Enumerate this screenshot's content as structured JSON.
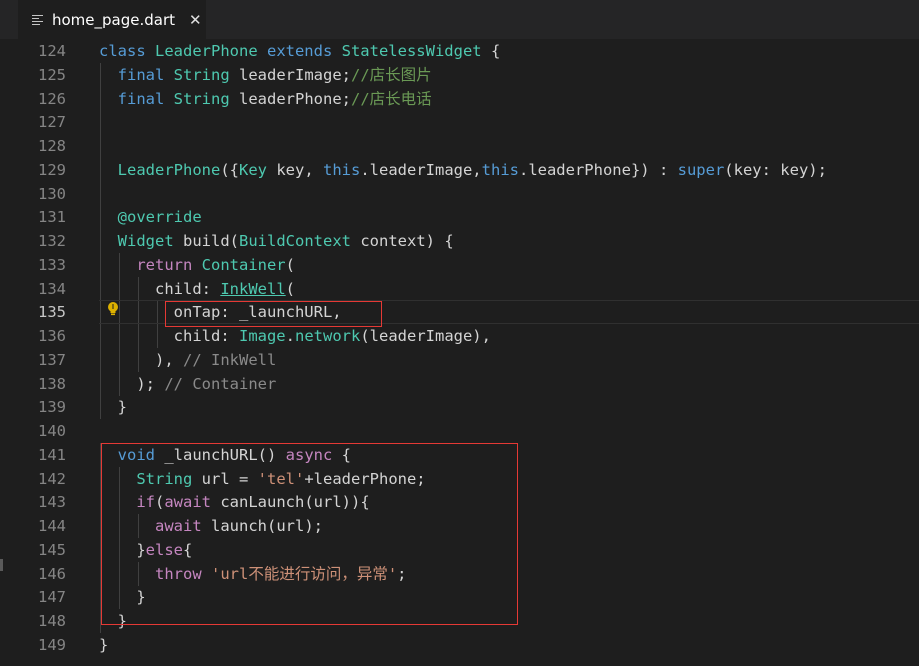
{
  "tab": {
    "filename": "home_page.dart",
    "close_glyph": "✕",
    "file_icon": "lines-file-icon"
  },
  "editor": {
    "active_line": "135",
    "lines": [
      {
        "n": "124",
        "tokens": [
          [
            "kw",
            "class "
          ],
          [
            "ty",
            "LeaderPhone "
          ],
          [
            "kw",
            "extends "
          ],
          [
            "ty",
            "StatelessWidget "
          ],
          [
            "var",
            "{"
          ]
        ]
      },
      {
        "n": "125",
        "tokens": [
          [
            "var",
            "  "
          ],
          [
            "kw",
            "final "
          ],
          [
            "ty",
            "String "
          ],
          [
            "var",
            "leaderImage;"
          ],
          [
            "cm",
            "//店长图片"
          ]
        ]
      },
      {
        "n": "126",
        "tokens": [
          [
            "var",
            "  "
          ],
          [
            "kw",
            "final "
          ],
          [
            "ty",
            "String "
          ],
          [
            "var",
            "leaderPhone;"
          ],
          [
            "cm",
            "//店长电话"
          ]
        ]
      },
      {
        "n": "127",
        "tokens": []
      },
      {
        "n": "128",
        "tokens": []
      },
      {
        "n": "129",
        "tokens": [
          [
            "var",
            "  "
          ],
          [
            "ty",
            "LeaderPhone"
          ],
          [
            "var",
            "({"
          ],
          [
            "ty",
            "Key "
          ],
          [
            "var",
            "key, "
          ],
          [
            "kw",
            "this"
          ],
          [
            "var",
            ".leaderImage,"
          ],
          [
            "kw",
            "this"
          ],
          [
            "var",
            ".leaderPhone}) : "
          ],
          [
            "kw",
            "super"
          ],
          [
            "var",
            "(key: key);"
          ]
        ]
      },
      {
        "n": "130",
        "tokens": []
      },
      {
        "n": "131",
        "tokens": [
          [
            "var",
            "  "
          ],
          [
            "dec",
            "@override"
          ]
        ]
      },
      {
        "n": "132",
        "tokens": [
          [
            "var",
            "  "
          ],
          [
            "ty",
            "Widget "
          ],
          [
            "var",
            "build("
          ],
          [
            "ty",
            "BuildContext "
          ],
          [
            "var",
            "context) {"
          ]
        ]
      },
      {
        "n": "133",
        "tokens": [
          [
            "var",
            "    "
          ],
          [
            "ctl",
            "return "
          ],
          [
            "ty",
            "Container"
          ],
          [
            "var",
            "("
          ]
        ]
      },
      {
        "n": "134",
        "tokens": [
          [
            "var",
            "      child: "
          ],
          [
            "link",
            "InkWell"
          ],
          [
            "var",
            "("
          ]
        ]
      },
      {
        "n": "135",
        "tokens": [
          [
            "var",
            "        onTap: _launchURL,"
          ]
        ]
      },
      {
        "n": "136",
        "tokens": [
          [
            "var",
            "        child: "
          ],
          [
            "ty",
            "Image"
          ],
          [
            "var",
            "."
          ],
          [
            "ty",
            "network"
          ],
          [
            "var",
            "(leaderImage),"
          ]
        ]
      },
      {
        "n": "137",
        "tokens": [
          [
            "var",
            "      ), "
          ],
          [
            "cmg",
            "// InkWell"
          ]
        ]
      },
      {
        "n": "138",
        "tokens": [
          [
            "var",
            "    ); "
          ],
          [
            "cmg",
            "// Container"
          ]
        ]
      },
      {
        "n": "139",
        "tokens": [
          [
            "var",
            "  }"
          ]
        ]
      },
      {
        "n": "140",
        "tokens": []
      },
      {
        "n": "141",
        "tokens": [
          [
            "var",
            "  "
          ],
          [
            "kw",
            "void "
          ],
          [
            "var",
            "_launchURL() "
          ],
          [
            "ctl",
            "async "
          ],
          [
            "var",
            "{"
          ]
        ]
      },
      {
        "n": "142",
        "tokens": [
          [
            "var",
            "    "
          ],
          [
            "ty",
            "String "
          ],
          [
            "var",
            "url = "
          ],
          [
            "str",
            "'tel'"
          ],
          [
            "var",
            "+leaderPhone;"
          ]
        ]
      },
      {
        "n": "143",
        "tokens": [
          [
            "var",
            "    "
          ],
          [
            "ctl",
            "if"
          ],
          [
            "var",
            "("
          ],
          [
            "ctl",
            "await "
          ],
          [
            "var",
            "canLaunch(url)){"
          ]
        ]
      },
      {
        "n": "144",
        "tokens": [
          [
            "var",
            "      "
          ],
          [
            "ctl",
            "await "
          ],
          [
            "var",
            "launch(url);"
          ]
        ]
      },
      {
        "n": "145",
        "tokens": [
          [
            "var",
            "    }"
          ],
          [
            "ctl",
            "else"
          ],
          [
            "var",
            "{"
          ]
        ]
      },
      {
        "n": "146",
        "tokens": [
          [
            "var",
            "      "
          ],
          [
            "ctl",
            "throw "
          ],
          [
            "str",
            "'url不能进行访问，异常'"
          ],
          [
            "var",
            ";"
          ]
        ]
      },
      {
        "n": "147",
        "tokens": [
          [
            "var",
            "    }"
          ]
        ]
      },
      {
        "n": "148",
        "tokens": [
          [
            "var",
            "  }"
          ]
        ]
      },
      {
        "n": "149",
        "tokens": [
          [
            "var",
            "}"
          ]
        ]
      }
    ]
  },
  "colors": {
    "background": "#1e1e1e",
    "highlight_box": "#e53935",
    "keyword": "#569cd6",
    "type": "#4ec9b0",
    "comment": "#6a9955",
    "string": "#ce9178",
    "control": "#c586c0"
  },
  "icons": {
    "lightbulb": "lightbulb-icon"
  }
}
